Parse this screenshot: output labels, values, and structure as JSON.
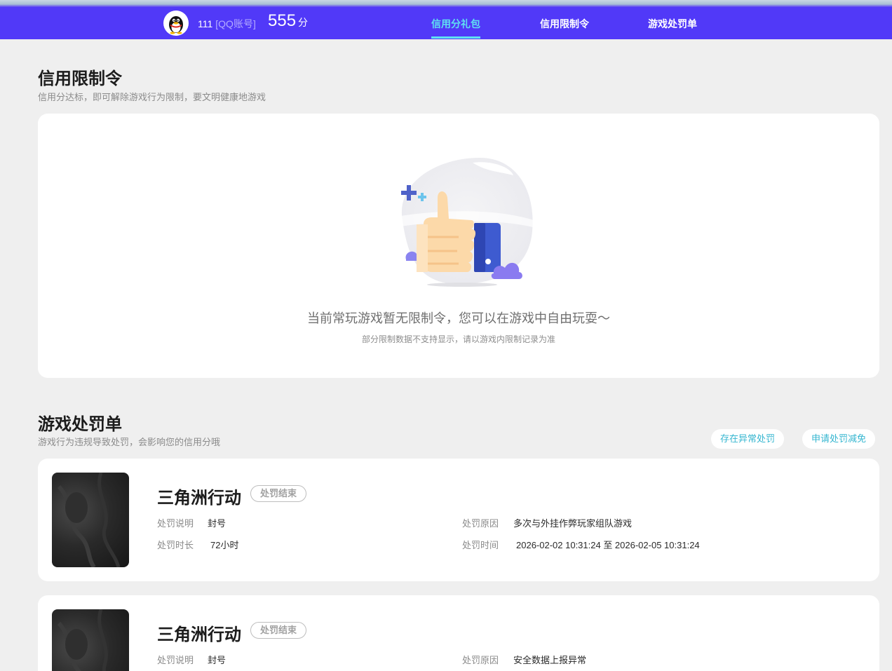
{
  "header": {
    "user_id": "111",
    "account_type": "[QQ账号]",
    "score": "555",
    "score_unit": "分",
    "tabs": [
      {
        "label": "信用分礼包",
        "active": true
      },
      {
        "label": "信用限制令",
        "active": false
      },
      {
        "label": "游戏处罚单",
        "active": false
      }
    ]
  },
  "restriction": {
    "title": "信用限制令",
    "subtitle": "信用分达标，即可解除游戏行为限制，要文明健康地游戏",
    "empty_message": "当前常玩游戏暂无限制令，您可以在游戏中自由玩耍～",
    "empty_note": "部分限制数据不支持显示，请以游戏内限制记录为准"
  },
  "penalty": {
    "title": "游戏处罚单",
    "subtitle": "游戏行为违规导致处罚，会影响您的信用分哦",
    "actions": {
      "abnormal": "存在异常处罚",
      "appeal": "申请处罚减免"
    },
    "labels": {
      "description": "处罚说明",
      "duration": "处罚时长",
      "reason": "处罚原因",
      "time": "处罚时间"
    },
    "items": [
      {
        "game": "三角洲行动",
        "status": "处罚结束",
        "description": "封号",
        "duration": "72小时",
        "reason": "多次与外挂作弊玩家组队游戏",
        "time": "2026-02-02 10:31:24 至 2026-02-05 10:31:24"
      },
      {
        "game": "三角洲行动",
        "status": "处罚结束",
        "description": "封号",
        "reason": "安全数据上报异常"
      }
    ]
  },
  "colors": {
    "nav_bg": "#5139f8",
    "active_tab": "#5fe1f2",
    "accent_link": "#35b6d0"
  }
}
